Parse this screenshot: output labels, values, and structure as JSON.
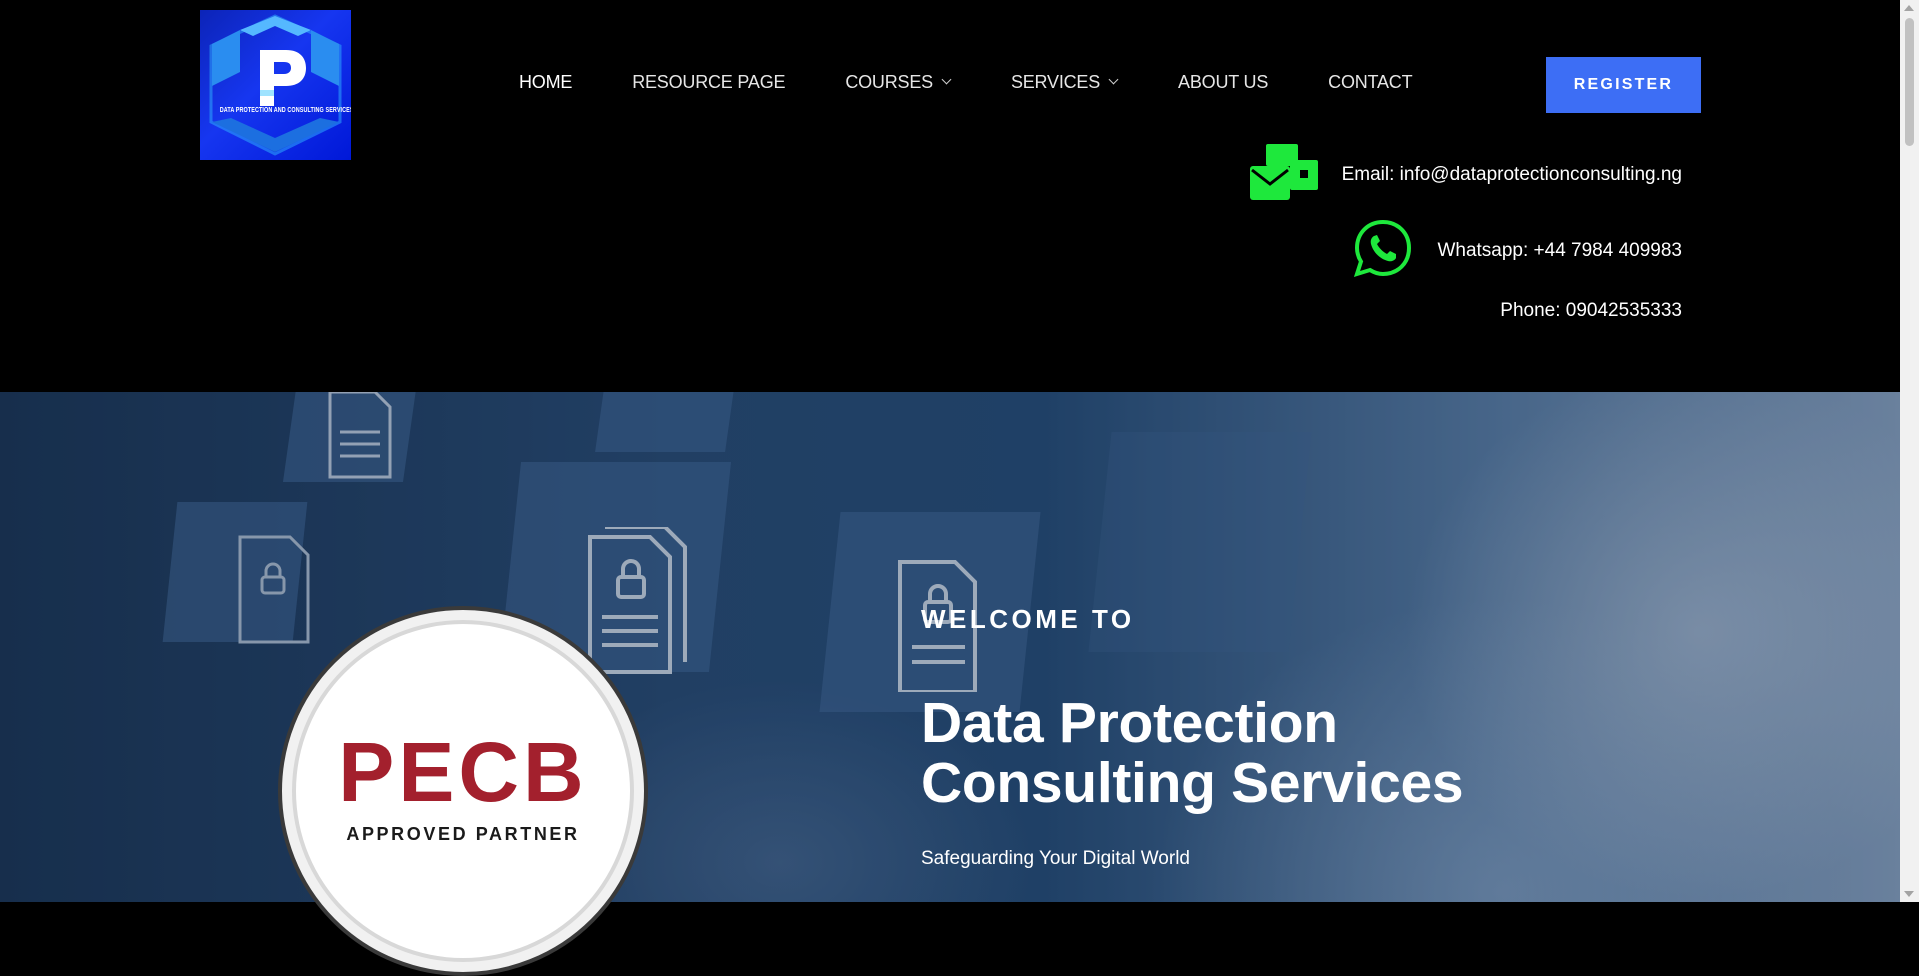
{
  "logo": {
    "text": "DATA PROTECTION AND CONSULTING SERVICES"
  },
  "nav": {
    "home": "HOME",
    "resource": "RESOURCE PAGE",
    "courses": "COURSES",
    "services": "SERVICES",
    "about": "ABOUT US",
    "contact": "CONTACT"
  },
  "register_label": "REGISTER",
  "contacts": {
    "email": "Email: info@dataprotectionconsulting.ng",
    "whatsapp": "Whatsapp: +44 7984 409983",
    "phone": "Phone: 09042535333"
  },
  "hero": {
    "welcome": "WELCOME TO",
    "title_line1": "Data Protection",
    "title_line2": "Consulting Services",
    "tagline": "Safeguarding Your Digital World"
  },
  "badge": {
    "brand": "PECB",
    "subtitle": "APPROVED PARTNER"
  },
  "colors": {
    "accent": "#3d6ef5",
    "icon_green": "#1ee83c",
    "brand_red": "#a3202d"
  }
}
